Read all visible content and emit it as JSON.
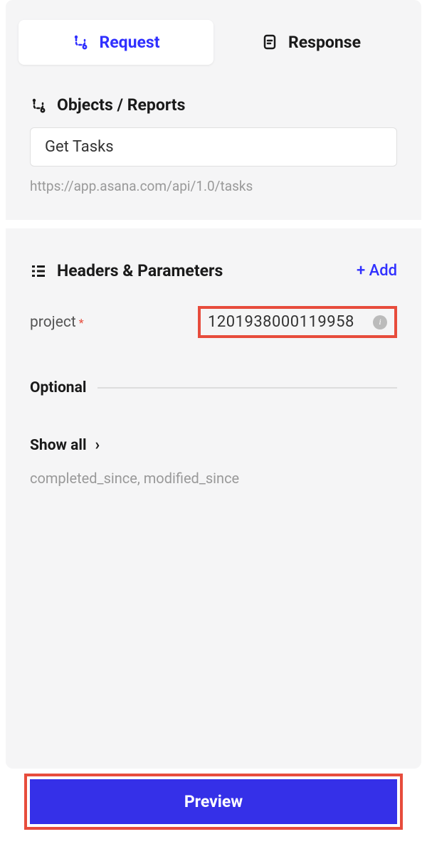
{
  "tabs": {
    "request": "Request",
    "response": "Response"
  },
  "objects": {
    "title": "Objects / Reports",
    "value": "Get Tasks",
    "url": "https://app.asana.com/api/1.0/tasks"
  },
  "params": {
    "title": "Headers & Parameters",
    "add": "+ Add",
    "project_label": "project",
    "project_value": "1201938000119958",
    "optional_label": "Optional",
    "show_all_label": "Show all",
    "show_all_desc": "completed_since, modified_since"
  },
  "preview": {
    "label": "Preview"
  }
}
